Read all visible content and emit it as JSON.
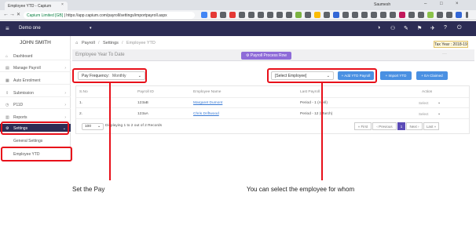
{
  "browser": {
    "tab_title": "Employee YTD - Capium",
    "tab_close": "×",
    "profile_name": "Saumesh",
    "window_controls": [
      "–",
      "□",
      "×"
    ],
    "nav": [
      "←",
      "→",
      "✕"
    ],
    "url_secure": "Capium Limited [GB]",
    "url_path": "https://app.capium.com/payroll/settings/importpayroll.aspx"
  },
  "appbar": {
    "menu_icon": "≡",
    "company": "Demo one",
    "company_caret": "▾",
    "icons": [
      "◑",
      "⚇",
      "✎",
      "⚑",
      "✈",
      "?",
      "⏻"
    ]
  },
  "sidebar": {
    "user_name": "JOHN SMITH",
    "items": [
      {
        "label": "Dashboard",
        "icon": "⌂"
      },
      {
        "label": "Manage Payroll",
        "icon": "▤",
        "chevron": "›"
      },
      {
        "label": "Auto Enrolment",
        "icon": "▦"
      },
      {
        "label": "Submission",
        "icon": "⇪",
        "chevron": "›"
      },
      {
        "label": "P11D",
        "icon": "◷",
        "chevron": "›"
      },
      {
        "label": "Reports",
        "icon": "▥",
        "chevron": "›"
      },
      {
        "label": "Settings",
        "icon": "⚙",
        "chevron": "⌄"
      }
    ],
    "sub_items": [
      "General Settings",
      "Employee YTD"
    ]
  },
  "breadcrumb": {
    "home_icon": "⌂",
    "items": [
      "Payroll",
      "/",
      "Settings",
      "/",
      "Employee YTD"
    ]
  },
  "tax_year": "Tax Year : 2018-19",
  "page": {
    "title": "Employee Year To Date",
    "process_button": "⚙ Payroll Process Row",
    "dots": "···"
  },
  "toolbar": {
    "pay_frequency_label": "Pay Frequency:",
    "pay_frequency_value": "Monthly",
    "caret": "⌄",
    "select_employee": "[Select Employee]",
    "add_ytd": "+ Add YTD Payroll",
    "import_ytd": "+ Import YTD",
    "ea_claimed": "+ EA Claimed"
  },
  "table": {
    "headers": [
      "S.No",
      "Payroll ID",
      "Employee Name",
      "Last Payroll",
      "Action"
    ],
    "rows": [
      {
        "sno": "1.",
        "id": "123aB",
        "name": "Margaret Dumont",
        "last": "Period - 1 (April)",
        "action": "Select"
      },
      {
        "sno": "2.",
        "id": "123aA",
        "name": "Chris Driftwood",
        "last": "Period - 12 (March)",
        "action": "Select"
      }
    ]
  },
  "pagination": {
    "page_size": "100",
    "showing": "Displaying 1 to 2 out of 2 Records",
    "buttons": [
      "« First",
      "‹ Previous",
      "1",
      "Next ›",
      "Last »"
    ]
  },
  "captions": {
    "left": "Set the Pay",
    "right": "You can select the employee for whom"
  },
  "colors": {
    "highlight": "#e8101a",
    "appbar": "#2c2c54",
    "primary_button": "#4a90e2",
    "purple_button": "#8e6bd8"
  }
}
